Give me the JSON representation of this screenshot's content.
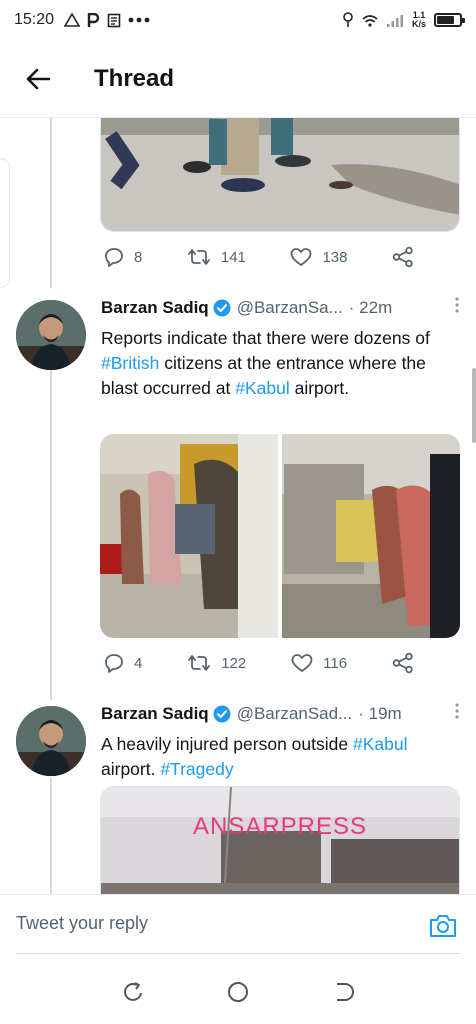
{
  "status_bar": {
    "time": "15:20",
    "left_icons": [
      "warning-icon",
      "p-icon",
      "notes-icon",
      "more-dots-icon"
    ],
    "speed_value": "1.1",
    "speed_unit": "K/s",
    "battery_level": 0.75
  },
  "header": {
    "title": "Thread"
  },
  "tweets": [
    {
      "stats": {
        "replies": "8",
        "retweets": "141",
        "likes": "138"
      }
    },
    {
      "name": "Barzan Sadiq",
      "handle": "@BarzanSa...",
      "time": "· 22m",
      "text_parts": [
        "Reports indicate that there were dozens of ",
        "#British",
        " citizens at the entrance where the blast occurred at ",
        "#Kabul",
        " airport."
      ],
      "stats": {
        "replies": "4",
        "retweets": "122",
        "likes": "116"
      }
    },
    {
      "name": "Barzan Sadiq",
      "handle": "@BarzanSad...",
      "time": "· 19m",
      "text_parts": [
        "A heavily injured person outside ",
        "#Kabul",
        " airport. ",
        "#Tragedy"
      ],
      "media_watermark": "ANSARPRESS"
    }
  ],
  "reply_bar": {
    "placeholder": "Tweet your reply"
  },
  "colors": {
    "accent": "#1d9bf0",
    "text": "#0f1419",
    "secondary": "#536471"
  }
}
